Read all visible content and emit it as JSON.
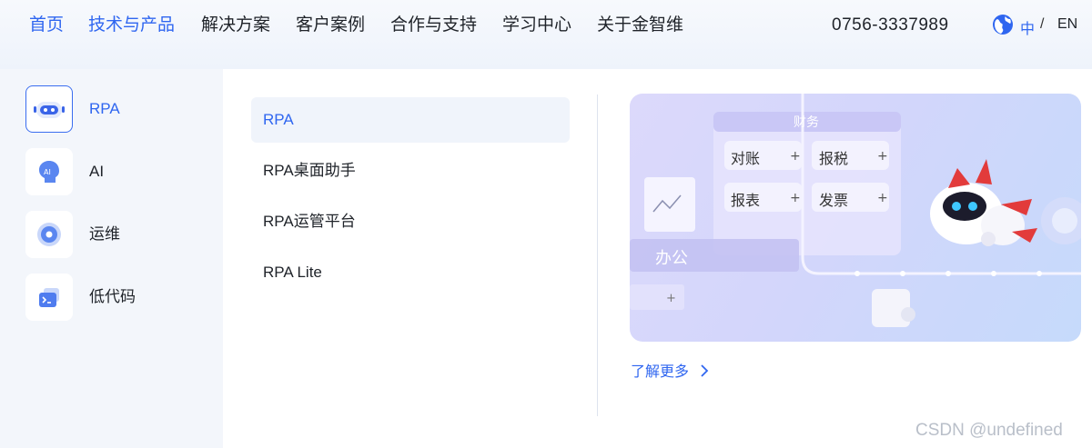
{
  "nav": {
    "items": [
      {
        "label": "首页",
        "active": true
      },
      {
        "label": "技术与产品",
        "active": true
      },
      {
        "label": "解决方案",
        "active": false
      },
      {
        "label": "客户案例",
        "active": false
      },
      {
        "label": "合作与支持",
        "active": false
      },
      {
        "label": "学习中心",
        "active": false
      },
      {
        "label": "关于金智维",
        "active": false
      }
    ],
    "phone": "0756-3337989",
    "lang_zh": "中",
    "lang_sep": "/",
    "lang_en": "EN"
  },
  "categories": [
    {
      "label": "RPA",
      "icon": "robot-icon",
      "active": true
    },
    {
      "label": "AI",
      "icon": "ai-head-icon",
      "active": false
    },
    {
      "label": "运维",
      "icon": "ops-icon",
      "active": false
    },
    {
      "label": "低代码",
      "icon": "lowcode-icon",
      "active": false
    }
  ],
  "subitems": [
    {
      "label": "RPA",
      "active": true
    },
    {
      "label": "RPA桌面助手",
      "active": false
    },
    {
      "label": "RPA运管平台",
      "active": false
    },
    {
      "label": "RPA Lite",
      "active": false
    }
  ],
  "banner": {
    "finance_title": "财务",
    "chips": [
      "对账",
      "报税",
      "报表",
      "发票"
    ],
    "office_label": "办公"
  },
  "learn_more": "了解更多",
  "watermark": "CSDN @undefined",
  "colors": {
    "accent": "#2f66f0",
    "panel_bg": "#ffffff",
    "side_bg": "#f3f6fb"
  }
}
